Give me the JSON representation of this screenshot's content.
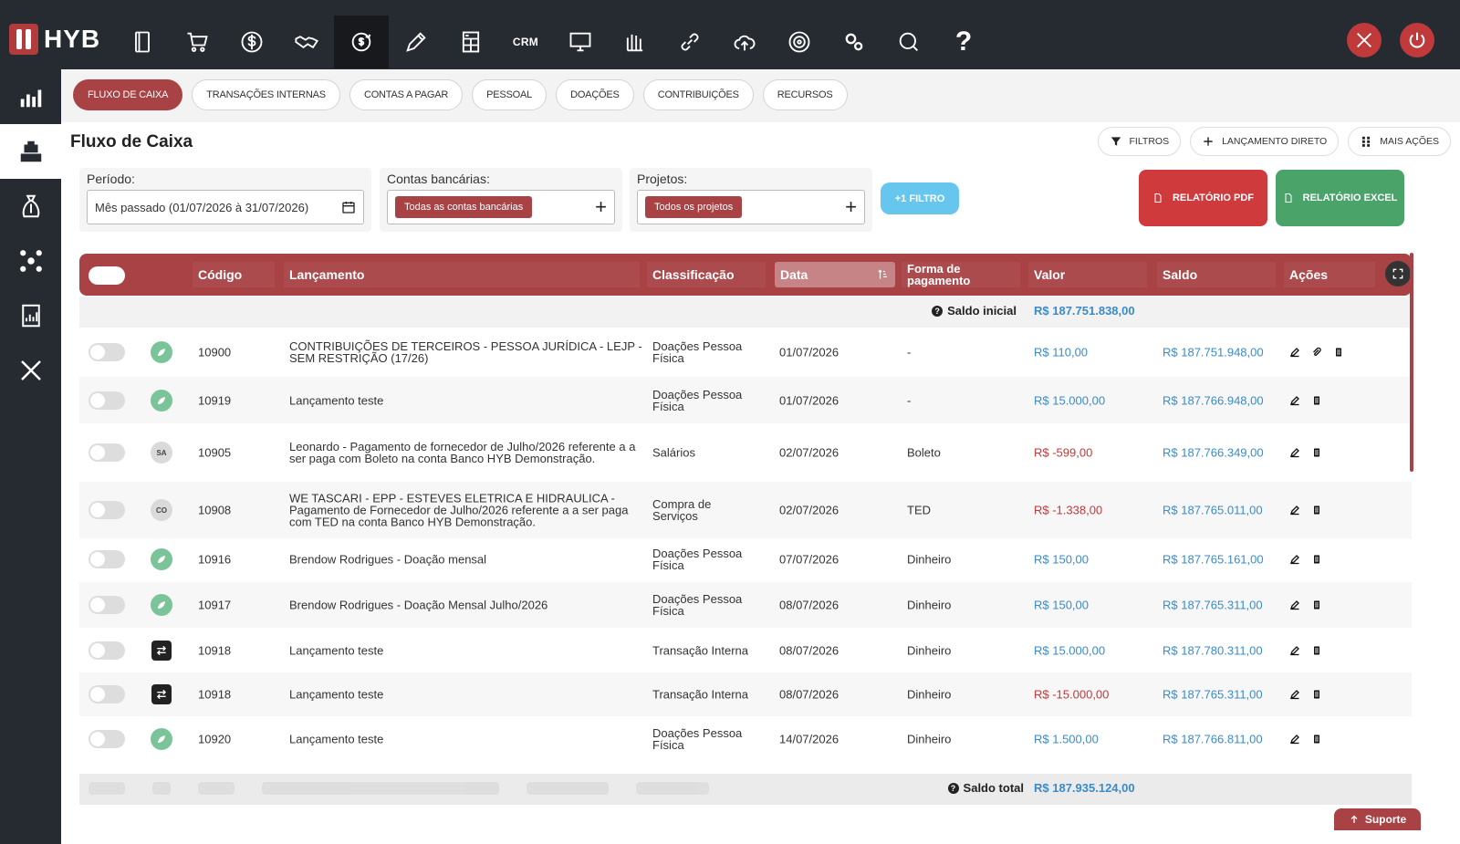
{
  "brand": {
    "name": "HYB"
  },
  "topnav": [
    {
      "icon": "file-icon"
    },
    {
      "icon": "cart-icon"
    },
    {
      "icon": "dollar-icon"
    },
    {
      "icon": "handshake-icon"
    },
    {
      "icon": "money-cycle-icon",
      "active": true
    },
    {
      "icon": "pencil-icon"
    },
    {
      "icon": "calculator-icon"
    },
    {
      "icon": "crm-icon",
      "label": "CRM"
    },
    {
      "icon": "monitor-icon"
    },
    {
      "icon": "hands-icon"
    },
    {
      "icon": "link-icon"
    },
    {
      "icon": "cloud-upload-icon"
    },
    {
      "icon": "target-icon"
    },
    {
      "icon": "gears-icon"
    },
    {
      "icon": "chat-icon"
    },
    {
      "icon": "help-icon",
      "label": "?"
    }
  ],
  "sidebar": [
    {
      "icon": "chart-icon"
    },
    {
      "icon": "cash-register-icon",
      "active": true
    },
    {
      "icon": "money-bag-icon"
    },
    {
      "icon": "network-icon"
    },
    {
      "icon": "report-icon"
    },
    {
      "icon": "tools-icon"
    }
  ],
  "tabs": [
    "FLUXO DE CAIXA",
    "TRANSAÇÕES INTERNAS",
    "CONTAS A PAGAR",
    "PESSOAL",
    "DOAÇÕES",
    "CONTRIBUIÇÕES",
    "RECURSOS"
  ],
  "page": {
    "title": "Fluxo de Caixa",
    "actions": {
      "filtros": "FILTROS",
      "lancamento": "LANÇAMENTO DIRETO",
      "mais": "MAIS AÇÕES"
    }
  },
  "filters": {
    "periodo_label": "Período:",
    "periodo_value": "Mês passado (01/07/2026 à 31/07/2026)",
    "contas_label": "Contas bancárias:",
    "contas_chip": "Todas as contas bancárias",
    "projetos_label": "Projetos:",
    "projetos_chip": "Todos os projetos",
    "add_filter": "+1 FILTRO",
    "report_pdf": "RELATÓRIO PDF",
    "report_excel": "RELATÓRIO EXCEL"
  },
  "table": {
    "headers": {
      "codigo": "Código",
      "lancamento": "Lançamento",
      "classificacao": "Classificação",
      "data": "Data",
      "forma": "Forma de pagamento",
      "valor": "Valor",
      "saldo": "Saldo",
      "acoes": "Ações"
    },
    "saldo_inicial_label": "Saldo inicial",
    "saldo_inicial_value": "R$ 187.751.838,00",
    "saldo_total_label": "Saldo total",
    "saldo_total_value": "R$ 187.935.124,00",
    "rows": [
      {
        "type_icon": "green",
        "code": "10900",
        "desc": "CONTRIBUIÇÕES DE TERCEIROS - PESSOA JURÍDICA - LEJP - SEM RESTRIÇÃO (17/26)",
        "class": "Doações Pessoa Física",
        "date": "01/07/2026",
        "forma": "-",
        "valor": "R$ 110,00",
        "sign": "pos",
        "saldo": "R$ 187.751.948,00",
        "attach": true
      },
      {
        "type_icon": "green",
        "code": "10919",
        "desc": "Lançamento teste",
        "class": "Doações Pessoa Física",
        "date": "01/07/2026",
        "forma": "-",
        "valor": "R$ 15.000,00",
        "sign": "pos",
        "saldo": "R$ 187.766.948,00"
      },
      {
        "type_icon": "gray",
        "badge": "SA",
        "code": "10905",
        "desc": "Leonardo              - Pagamento de fornecedor de Julho/2026 referente a a ser paga com Boleto na conta Banco HYB Demonstração.",
        "class": "Salários",
        "date": "02/07/2026",
        "forma": "Boleto",
        "valor": "R$ -599,00",
        "sign": "neg",
        "saldo": "R$ 187.766.349,00"
      },
      {
        "type_icon": "gray",
        "badge": "CO",
        "code": "10908",
        "desc": "WE TASCARI - EPP - ESTEVES ELETRICA E HIDRAULICA - Pagamento de Fornecedor de Julho/2026 referente a a ser paga com TED na conta Banco HYB Demonstração.",
        "class": "Compra de Serviços",
        "date": "02/07/2026",
        "forma": "TED",
        "valor": "R$ -1.338,00",
        "sign": "neg",
        "saldo": "R$ 187.765.011,00"
      },
      {
        "type_icon": "green",
        "code": "10916",
        "desc": "Brendow Rodrigues - Doação mensal",
        "class": "Doações Pessoa Física",
        "date": "07/07/2026",
        "forma": "Dinheiro",
        "valor": "R$ 150,00",
        "sign": "pos",
        "saldo": "R$ 187.765.161,00"
      },
      {
        "type_icon": "green",
        "code": "10917",
        "desc": "Brendow Rodrigues - Doação Mensal Julho/2026",
        "class": "Doações Pessoa Física",
        "date": "08/07/2026",
        "forma": "Dinheiro",
        "valor": "R$ 150,00",
        "sign": "pos",
        "saldo": "R$ 187.765.311,00"
      },
      {
        "type_icon": "swap",
        "code": "10918",
        "desc": "Lançamento teste",
        "class": "Transação Interna",
        "date": "08/07/2026",
        "forma": "Dinheiro",
        "valor": "R$ 15.000,00",
        "sign": "pos",
        "saldo": "R$ 187.780.311,00"
      },
      {
        "type_icon": "swap",
        "code": "10918",
        "desc": "Lançamento teste",
        "class": "Transação Interna",
        "date": "08/07/2026",
        "forma": "Dinheiro",
        "valor": "R$ -15.000,00",
        "sign": "neg",
        "saldo": "R$ 187.765.311,00"
      },
      {
        "type_icon": "green",
        "code": "10920",
        "desc": "Lançamento teste",
        "class": "Doações Pessoa Física",
        "date": "14/07/2026",
        "forma": "Dinheiro",
        "valor": "R$ 1.500,00",
        "sign": "pos",
        "saldo": "R$ 187.766.811,00"
      }
    ]
  },
  "support": "Suporte",
  "colors": {
    "primary": "#a84245",
    "dark": "#262a31",
    "positive": "#3a8bc9",
    "negative": "#c0393b",
    "excel": "#4aa368",
    "pdf": "#cf3b3c",
    "filter": "#66c6ee"
  }
}
